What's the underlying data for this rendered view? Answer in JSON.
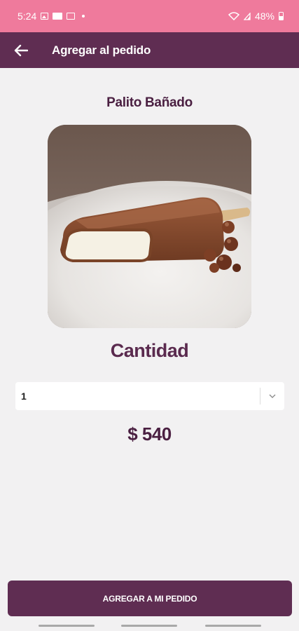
{
  "status_bar": {
    "time": "5:24",
    "battery": "48%",
    "icons": [
      "image-icon",
      "mail-icon",
      "card-icon",
      "dot-icon",
      "wifi-icon",
      "signal-icon",
      "battery-icon"
    ]
  },
  "app_bar": {
    "back_icon": "arrow-left-icon",
    "title": "Agregar al pedido"
  },
  "product": {
    "name": "Palito Bañado",
    "image": "chocolate-coated-ice-cream-bar"
  },
  "quantity": {
    "title": "Cantidad",
    "selected": "1"
  },
  "price": "$ 540",
  "actions": {
    "add_label": "AGREGAR A MI PEDIDO"
  },
  "colors": {
    "status_bar": "#ef7a9c",
    "primary": "#5f2d52",
    "text_dark": "#4a1f41",
    "background": "#f2f1f2"
  }
}
